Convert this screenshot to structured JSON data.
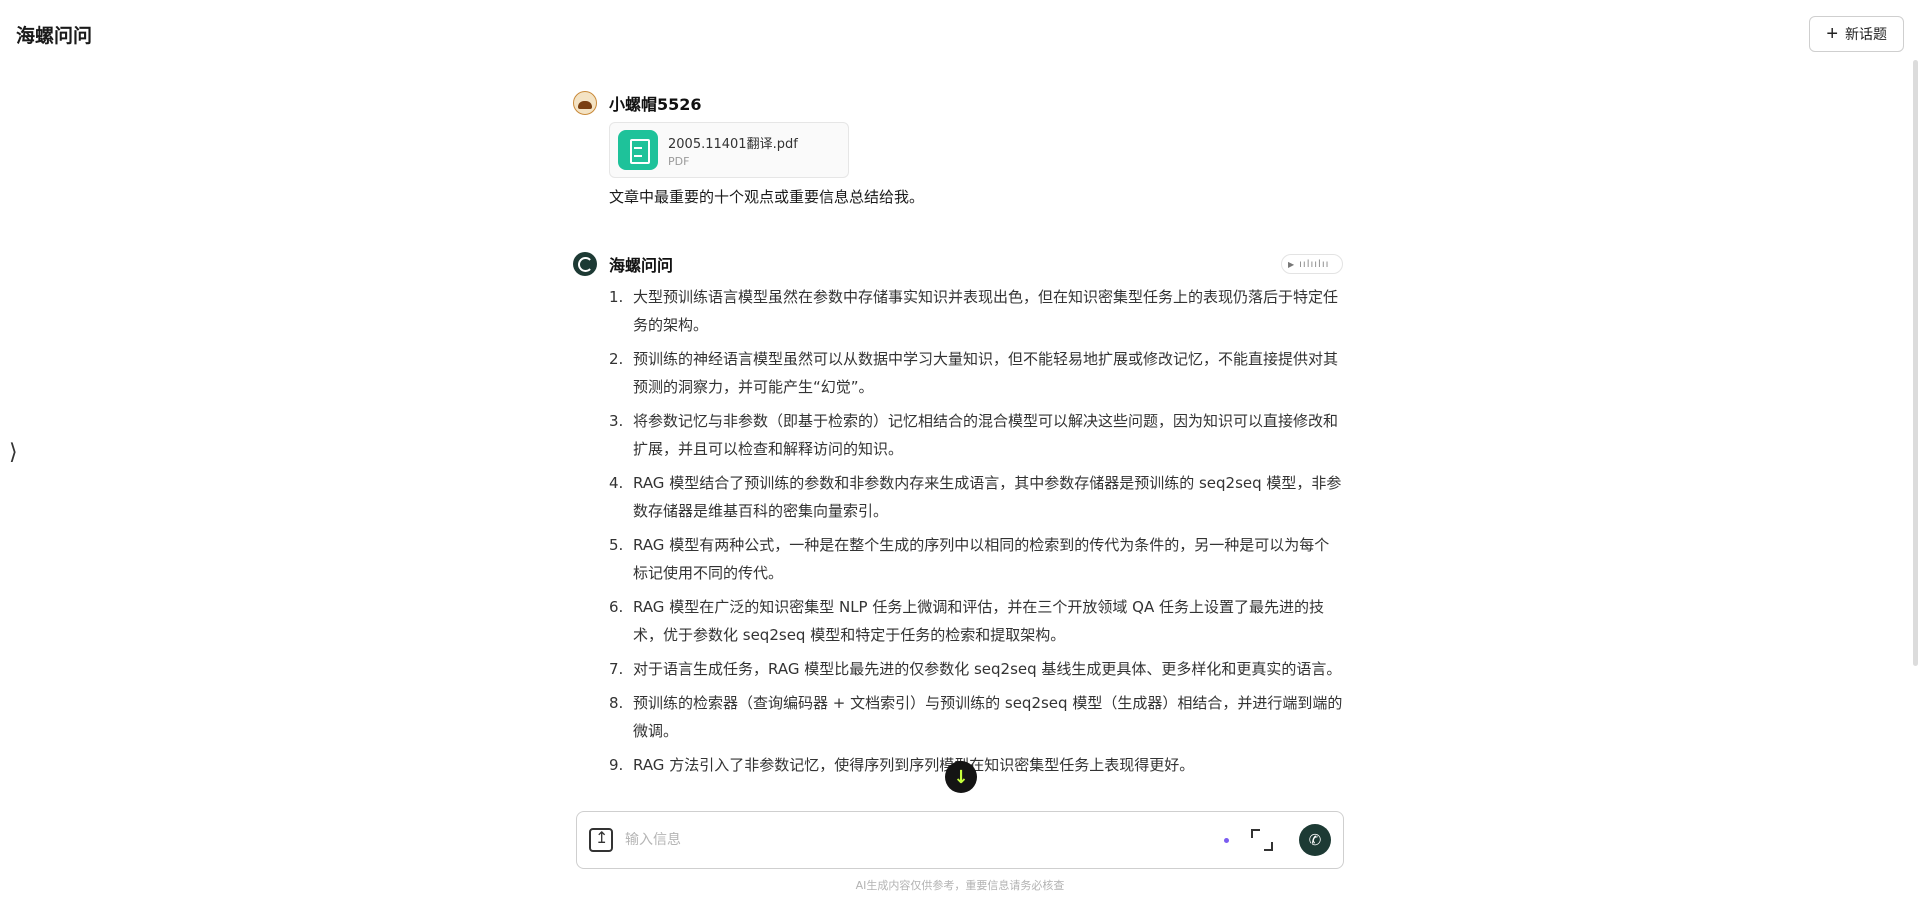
{
  "header": {
    "app_title": "海螺问问",
    "new_topic_label": "新话题"
  },
  "sidebar": {
    "toggle_glyph": "⟩"
  },
  "user_message": {
    "name": "小螺帽5526",
    "attachment": {
      "file_name": "2005.11401翻译.pdf",
      "file_type": "PDF"
    },
    "text": "文章中最重要的十个观点或重要信息总结给我。"
  },
  "bot_message": {
    "name": "海螺问问",
    "voice_icon": "play-icon",
    "items": [
      {
        "num": "1.",
        "text": "大型预训练语言模型虽然在参数中存储事实知识并表现出色，但在知识密集型任务上的表现仍落后于特定任务的架构。"
      },
      {
        "num": "2.",
        "text": "预训练的神经语言模型虽然可以从数据中学习大量知识，但不能轻易地扩展或修改记忆，不能直接提供对其预测的洞察力，并可能产生“幻觉”。"
      },
      {
        "num": "3.",
        "text": "将参数记忆与非参数（即基于检索的）记忆相结合的混合模型可以解决这些问题，因为知识可以直接修改和扩展，并且可以检查和解释访问的知识。"
      },
      {
        "num": "4.",
        "text": "RAG 模型结合了预训练的参数和非参数内存来生成语言，其中参数存储器是预训练的 seq2seq 模型，非参数存储器是维基百科的密集向量索引。"
      },
      {
        "num": "5.",
        "text": "RAG 模型有两种公式，一种是在整个生成的序列中以相同的检索到的传代为条件的，另一种是可以为每个标记使用不同的传代。"
      },
      {
        "num": "6.",
        "text": "RAG 模型在广泛的知识密集型 NLP 任务上微调和评估，并在三个开放领域 QA 任务上设置了最先进的技术，优于参数化 seq2seq 模型和特定于任务的检索和提取架构。"
      },
      {
        "num": "7.",
        "text": "对于语言生成任务，RAG 模型比最先进的仅参数化 seq2seq 基线生成更具体、更多样化和更真实的语言。"
      },
      {
        "num": "8.",
        "text": "预训练的检索器（查询编码器 + 文档索引）与预训练的 seq2seq 模型（生成器）相结合，并进行端到端的微调。"
      },
      {
        "num": "9.",
        "text": "RAG 方法引入了非参数记忆，使得序列到序列模型在知识密集型任务上表现得更好。"
      }
    ]
  },
  "composer": {
    "placeholder": "输入信息",
    "scroll_down_glyph": "↓",
    "call_glyph": "✆"
  },
  "footer": {
    "disclaimer": "AI生成内容仅供参考，重要信息请务必核查"
  }
}
